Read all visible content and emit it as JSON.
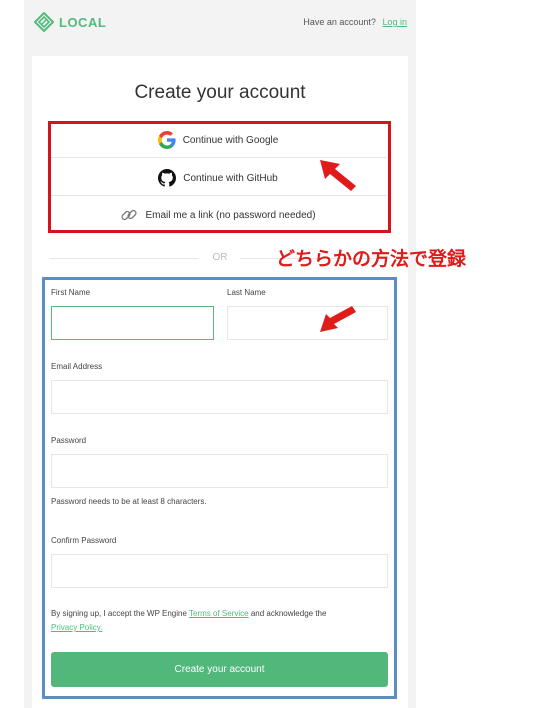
{
  "header": {
    "logo_text": "LOCAL",
    "have_account_text": "Have an account?",
    "login_link": "Log in"
  },
  "title": "Create your account",
  "sso": {
    "google": "Continue with Google",
    "github": "Continue with GitHub",
    "email": "Email me a link (no password needed)"
  },
  "divider": "OR",
  "annotation": "どちらかの方法で登録",
  "form": {
    "first_name_label": "First Name",
    "first_name_value": "",
    "last_name_label": "Last Name",
    "last_name_value": "",
    "email_label": "Email Address",
    "email_value": "",
    "password_label": "Password",
    "password_value": "",
    "password_hint": "Password needs to be at least 8 characters.",
    "confirm_label": "Confirm Password",
    "confirm_value": "",
    "terms_prefix": "By signing up, I accept the WP Engine",
    "terms_link": "Terms of Service",
    "terms_middle": "and acknowledge the",
    "privacy_link": "Privacy Policy.",
    "submit": "Create your account"
  },
  "colors": {
    "brand_green": "#51bb7b",
    "button_green": "#52b77a",
    "annotation_red": "#d6121a",
    "highlight_blue": "#5b8ec1"
  },
  "icons": [
    "local-logo-icon",
    "google-icon",
    "github-icon",
    "link-icon",
    "red-arrow-icon"
  ]
}
